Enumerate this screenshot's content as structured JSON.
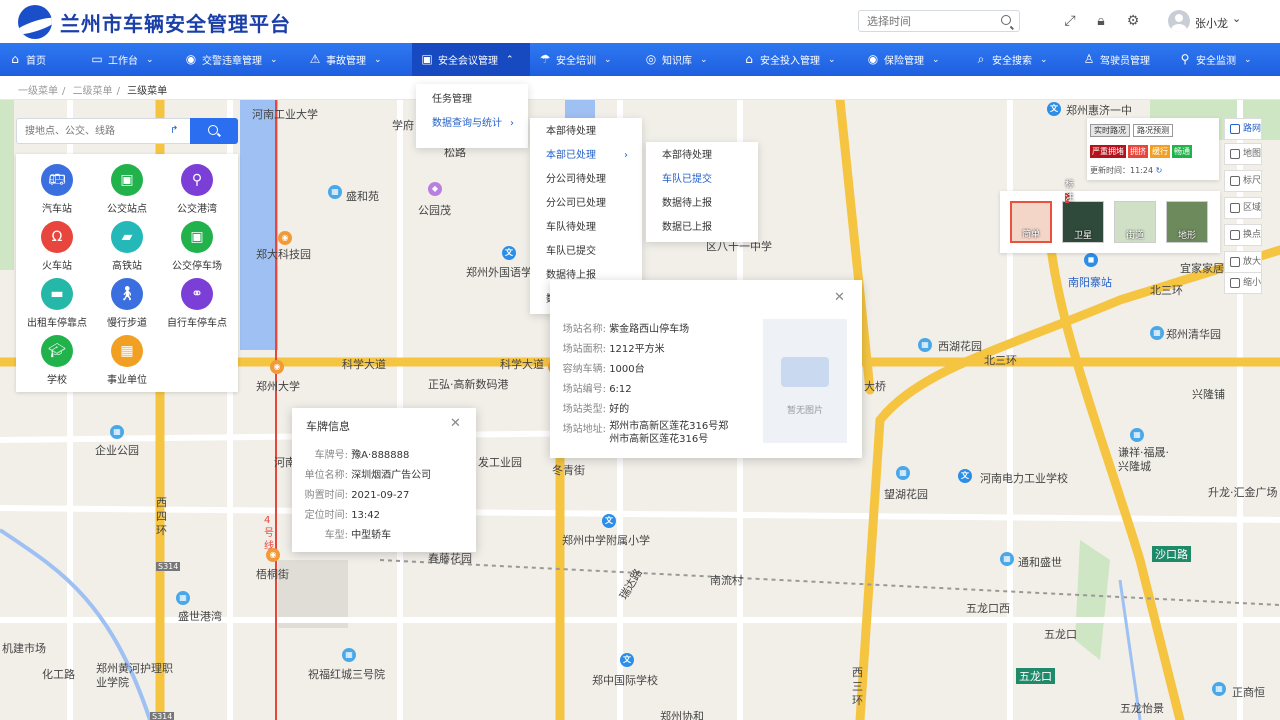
{
  "app": {
    "title": "兰州市车辆安全管理平台"
  },
  "header": {
    "time_placeholder": "选择时间",
    "user_name": "张小龙"
  },
  "nav": [
    {
      "label": "首页",
      "icon": "home-icon"
    },
    {
      "label": "工作台",
      "icon": "monitor-icon"
    },
    {
      "label": "交警违章管理",
      "icon": "violation-icon"
    },
    {
      "label": "事故管理",
      "icon": "warning-icon"
    },
    {
      "label": "安全会议管理",
      "icon": "meeting-icon"
    },
    {
      "label": "安全培训",
      "icon": "training-icon"
    },
    {
      "label": "知识库",
      "icon": "knowledge-icon"
    },
    {
      "label": "安全投入管理",
      "icon": "investment-icon"
    },
    {
      "label": "保险管理",
      "icon": "insurance-icon"
    },
    {
      "label": "安全搜索",
      "icon": "search-icon"
    },
    {
      "label": "驾驶员管理",
      "icon": "driver-icon"
    },
    {
      "label": "安全监测",
      "icon": "location-icon"
    }
  ],
  "breadcrumb": [
    "一级菜单",
    "二级菜单",
    "三级菜单"
  ],
  "dropdown": {
    "level1": [
      "任务管理",
      "数据查询与统计"
    ],
    "level2": [
      "本部待处理",
      "本部已处理",
      "分公司待处理",
      "分公司已处理",
      "车队待处理",
      "车队已提交",
      "数据待上报",
      "数据已上报"
    ],
    "level3": [
      "本部待处理",
      "车队已提交",
      "数据待上报",
      "数据已上报"
    ]
  },
  "search": {
    "placeholder": "搜地点、公交、线路"
  },
  "categories": [
    {
      "label": "汽车站",
      "color": "#3b6fe0"
    },
    {
      "label": "公交站点",
      "color": "#22b24c"
    },
    {
      "label": "公交港湾",
      "color": "#7b3fd8"
    },
    {
      "label": "火车站",
      "color": "#e8453c"
    },
    {
      "label": "高铁站",
      "color": "#25b8b8"
    },
    {
      "label": "公交停车场",
      "color": "#22b24c"
    },
    {
      "label": "出租车停靠点",
      "color": "#25b8a8"
    },
    {
      "label": "慢行步道",
      "color": "#3b6fe0"
    },
    {
      "label": "自行车停车点",
      "color": "#7b3fd8"
    },
    {
      "label": "学校",
      "color": "#22b24c"
    },
    {
      "label": "事业单位",
      "color": "#f2a024"
    }
  ],
  "vehicle_info": {
    "title": "车牌信息",
    "rows": [
      {
        "k": "车牌号:",
        "v": "豫A·888888"
      },
      {
        "k": "单位名称:",
        "v": "深圳烟酒广告公司"
      },
      {
        "k": "购置时间:",
        "v": "2021-09-27"
      },
      {
        "k": "定位时间:",
        "v": "13:42"
      },
      {
        "k": "车型:",
        "v": "中型轿车"
      }
    ]
  },
  "station_info": {
    "rows": [
      {
        "k": "场站名称:",
        "v": "紫金路西山停车场"
      },
      {
        "k": "场站面积:",
        "v": "1212平方米"
      },
      {
        "k": "容纳车辆:",
        "v": "1000台"
      },
      {
        "k": "场站编号:",
        "v": "6:12"
      },
      {
        "k": "场站类型:",
        "v": "好的"
      },
      {
        "k": "场站地址:",
        "v": "郑州市高新区莲花316号郑州市高新区莲花316号"
      }
    ],
    "no_image": "暂无图片"
  },
  "traffic": {
    "realtime": "实时路况",
    "forecast": "路况预测",
    "legend": [
      {
        "label": "严重拥堵",
        "color": "#b5121b"
      },
      {
        "label": "拥挤",
        "color": "#e8453c"
      },
      {
        "label": "缓行",
        "color": "#f2a024"
      },
      {
        "label": "畅通",
        "color": "#22b24c"
      }
    ],
    "update_label": "更新时间：",
    "update_time": "11:24"
  },
  "map_types": [
    "简单",
    "卫星",
    "街道",
    "地形"
  ],
  "satellite_tag": "标注",
  "tools": [
    "路网",
    "地图",
    "标尺",
    "区域",
    "换点",
    "放大",
    "缩小"
  ],
  "map_labels": [
    "河南工业大学",
    "学府",
    "松路",
    "盛和苑",
    "公园茂",
    "郑大科技园",
    "郑州外国语学",
    "科学大道",
    "科学大道",
    "郑州大学",
    "正弘·高新数码港",
    "企业公园",
    "河南",
    "梧桐街",
    "盛世港湾",
    "郑州黄河护理职业学院",
    "祝福红城三号院",
    "郑州中学附属小学",
    "冬青街",
    "发工业园",
    "春藤花园",
    "南流村",
    "郑中国际学校",
    "郑州惠济一中",
    "南阳寨站",
    "北三环",
    "北三环",
    "郑州清华园",
    "西湖花园",
    "望湖花园",
    "大桥",
    "河南电力工业学校",
    "谦祥·福晟·兴隆城",
    "升龙·汇金广场",
    "兴隆铺",
    "通和盛世",
    "沙口路",
    "五龙口西",
    "五龙口",
    "五龙口",
    "宜家家居",
    "正商恒",
    "五龙怡景",
    "郑州协和",
    "区八十一中学",
    "机建市场",
    "化工路",
    "西四环",
    "西三环",
    "S314",
    "S314",
    "4号线",
    "瑞达路"
  ]
}
